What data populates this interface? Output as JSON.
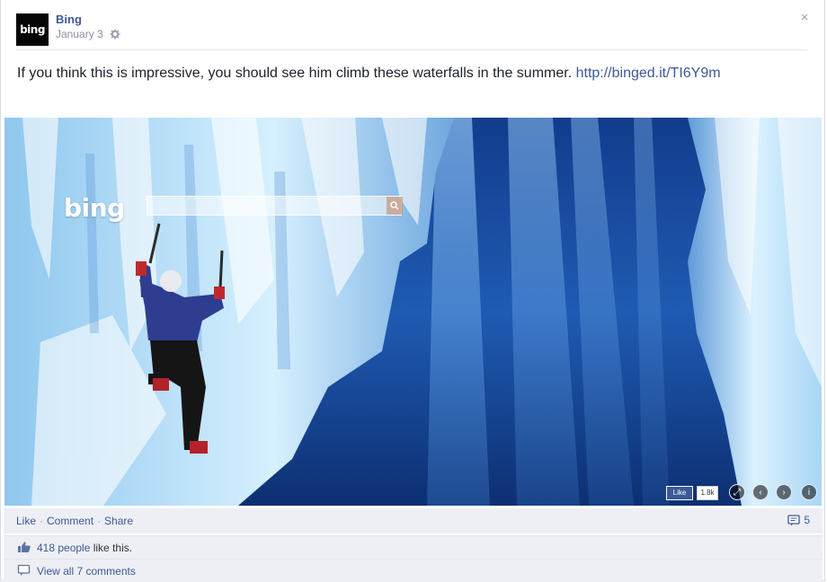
{
  "post": {
    "page_name": "Bing",
    "date": "January 3",
    "avatar_text": "bing",
    "message_text": "If you think this is impressive, you should see him climb these waterfalls in the summer. ",
    "message_link": "http://binged.it/TI6Y9m",
    "close_symbol": "×"
  },
  "photo": {
    "logo_text": "bing",
    "fb_like": "Like",
    "fb_count": "1.8k",
    "controls": [
      "expand-icon",
      "prev-icon",
      "next-icon",
      "info-icon"
    ],
    "controls_glyphs": [
      "⤢",
      "‹",
      "›",
      "i"
    ]
  },
  "actions": {
    "like": "Like",
    "comment": "Comment",
    "share": "Share",
    "separator": "·",
    "comment_count": "5"
  },
  "likes": {
    "people_link": "418 people",
    "suffix": " like this."
  },
  "comments": {
    "view_all": "View all 7 comments"
  },
  "colors": {
    "link": "#3b5998",
    "bar_bg": "#edeff4"
  }
}
